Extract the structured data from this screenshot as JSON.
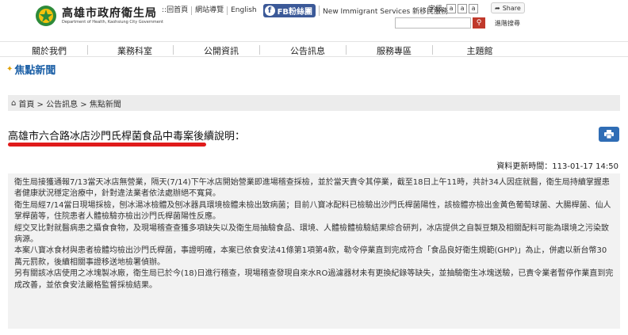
{
  "header": {
    "logo_title": "高雄市政府衛生局",
    "logo_subtitle": "Department of Health, Kaohsiung City Government",
    "top_links": [
      "::回首頁",
      "網站導覽",
      "English"
    ],
    "fb_label": "FB粉絲團",
    "immigrant_link": "New Immigrant Services 新移民服務",
    "font_size_label": "字級:",
    "font_sizes": [
      "a",
      "a",
      "a"
    ],
    "share_label": "Share",
    "search_placeholder": "",
    "advanced_search": "進階搜尋"
  },
  "nav": {
    "items": [
      "關於我們",
      "業務科室",
      "公開資訊",
      "公告訊息",
      "服務專區",
      "主題館"
    ]
  },
  "section": {
    "title": "焦點新聞"
  },
  "breadcrumb": {
    "text": "首頁 > 公告訊息 > 焦點新聞"
  },
  "article": {
    "title": "高雄市六合路冰店沙門氏桿菌食品中毒案後續說明：",
    "update_label": "資料更新時間：113-01-17 14:50",
    "paragraphs": [
      "衛生局接獲通報7/13當天冰店無營業，隔天(7/14)下午冰店開始營業即進場稽查採檢，並於當天責令其停業，截至18日上午11時，共計34人因症就醫，衛生局持續掌握患者健康狀況穩定治療中，針對違法業者依法處辦絕不寬貸。",
      "衛生局經7/14當日現場採檢，刨冰湯冰檢體及刨冰器具環境檢體未檢出致病菌；目前八寶冰配料已檢驗出沙門氏桿菌陽性，該檢體亦檢出金黃色葡萄球菌、大腸桿菌、仙人掌桿菌等，住院患者人體檢驗亦檢出沙門氏桿菌陽性反應。",
      "經交叉比對就醫病患之攝食食物，及現場稽查查獲多項缺失以及衛生局抽驗食品、環境、人體檢體檢驗結果綜合研判，冰店提供之自製豆類及相關配料可能為環境之污染致病源。",
      "本案八寶冰食材與患者檢體均檢出沙門氏桿菌，事證明確，本案已依食安法41條第1項第4款，勒令停業直到完成符合「食品良好衛生規範(GHP)」為止，併處以新台幣30萬元罰款，後續相關事證移送地檢署偵辦。",
      "另有關該冰店使用之冰塊製冰廠，衛生局已於今(18)日進行稽查，現場稽查發現自來水RO過濾器材未有更換紀錄等缺失，並抽驗衛生冰塊送驗，已責令業者暫停作業直到完成改善，並依食安法嚴格監督採檢結果。"
    ]
  },
  "colors": {
    "accent": "#1b5fa6",
    "underline": "#e01b1b",
    "print_button": "#2f6db5",
    "fb": "#3b5998"
  }
}
